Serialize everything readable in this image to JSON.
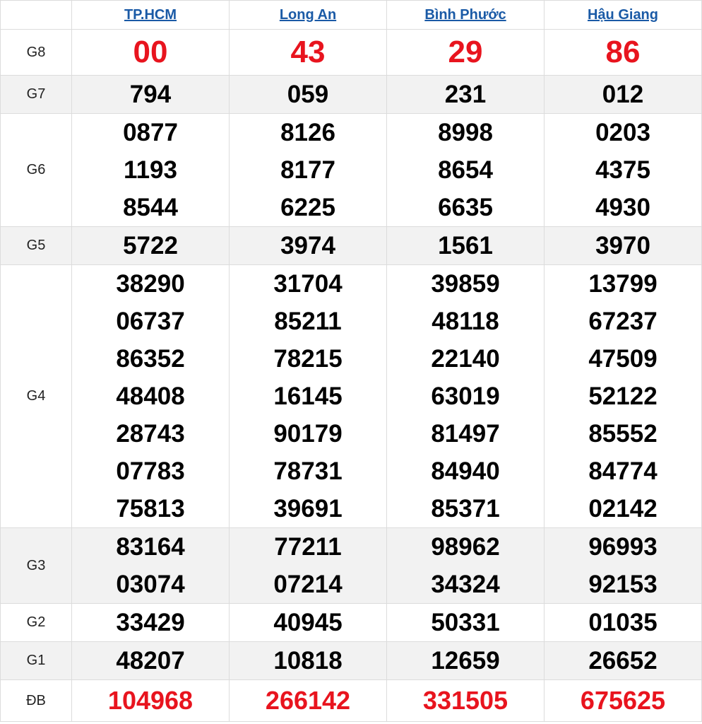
{
  "provinces": [
    "TP.HCM",
    "Long An",
    "Bình Phước",
    "Hậu Giang"
  ],
  "prizes": [
    {
      "label": "G8",
      "values": [
        [
          "00"
        ],
        [
          "43"
        ],
        [
          "29"
        ],
        [
          "86"
        ]
      ]
    },
    {
      "label": "G7",
      "values": [
        [
          "794"
        ],
        [
          "059"
        ],
        [
          "231"
        ],
        [
          "012"
        ]
      ]
    },
    {
      "label": "G6",
      "values": [
        [
          "0877",
          "1193",
          "8544"
        ],
        [
          "8126",
          "8177",
          "6225"
        ],
        [
          "8998",
          "8654",
          "6635"
        ],
        [
          "0203",
          "4375",
          "4930"
        ]
      ]
    },
    {
      "label": "G5",
      "values": [
        [
          "5722"
        ],
        [
          "3974"
        ],
        [
          "1561"
        ],
        [
          "3970"
        ]
      ]
    },
    {
      "label": "G4",
      "values": [
        [
          "38290",
          "06737",
          "86352",
          "48408",
          "28743",
          "07783",
          "75813"
        ],
        [
          "31704",
          "85211",
          "78215",
          "16145",
          "90179",
          "78731",
          "39691"
        ],
        [
          "39859",
          "48118",
          "22140",
          "63019",
          "81497",
          "84940",
          "85371"
        ],
        [
          "13799",
          "67237",
          "47509",
          "52122",
          "85552",
          "84774",
          "02142"
        ]
      ]
    },
    {
      "label": "G3",
      "values": [
        [
          "83164",
          "03074"
        ],
        [
          "77211",
          "07214"
        ],
        [
          "98962",
          "34324"
        ],
        [
          "96993",
          "92153"
        ]
      ]
    },
    {
      "label": "G2",
      "values": [
        [
          "33429"
        ],
        [
          "40945"
        ],
        [
          "50331"
        ],
        [
          "01035"
        ]
      ]
    },
    {
      "label": "G1",
      "values": [
        [
          "48207"
        ],
        [
          "10818"
        ],
        [
          "12659"
        ],
        [
          "26652"
        ]
      ]
    },
    {
      "label": "ĐB",
      "values": [
        [
          "104968"
        ],
        [
          "266142"
        ],
        [
          "331505"
        ],
        [
          "675625"
        ]
      ]
    }
  ],
  "colors": {
    "link": "#1a5aa6",
    "highlight": "#e8141e",
    "shade": "#f2f2f2"
  }
}
